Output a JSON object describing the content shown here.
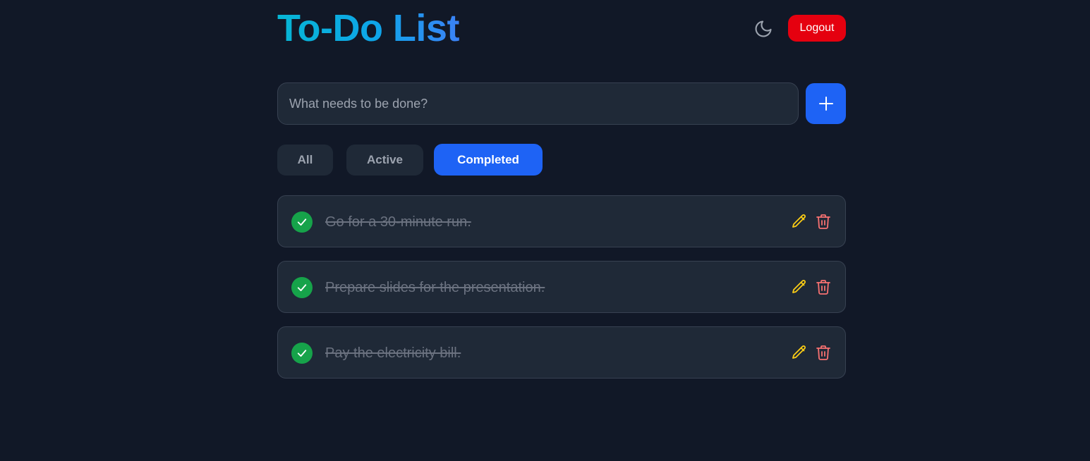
{
  "header": {
    "title": "To-Do List",
    "theme_icon": "moon-icon",
    "logout_label": "Logout"
  },
  "add_task": {
    "placeholder": "What needs to be done?",
    "value": "",
    "add_icon": "plus-icon"
  },
  "filters": [
    {
      "label": "All",
      "selected": false
    },
    {
      "label": "Active",
      "selected": false
    },
    {
      "label": "Completed",
      "selected": true
    }
  ],
  "todos": [
    {
      "text": "Go for a 30-minute run.",
      "completed": true
    },
    {
      "text": "Prepare slides for the presentation.",
      "completed": true
    },
    {
      "text": "Pay the electricity bill.",
      "completed": true
    }
  ],
  "icons": {
    "check": "check-icon",
    "edit": "pencil-icon",
    "delete": "trash-icon"
  },
  "colors": {
    "background": "#111827",
    "card": "#1f2937",
    "primary": "#1e63f5",
    "logout": "#e5000f",
    "complete": "#16a34a",
    "edit_icon": "#facc15",
    "delete_icon": "#f87171",
    "title_gradient_start": "#06b6d4",
    "title_gradient_end": "#3b82f6"
  }
}
